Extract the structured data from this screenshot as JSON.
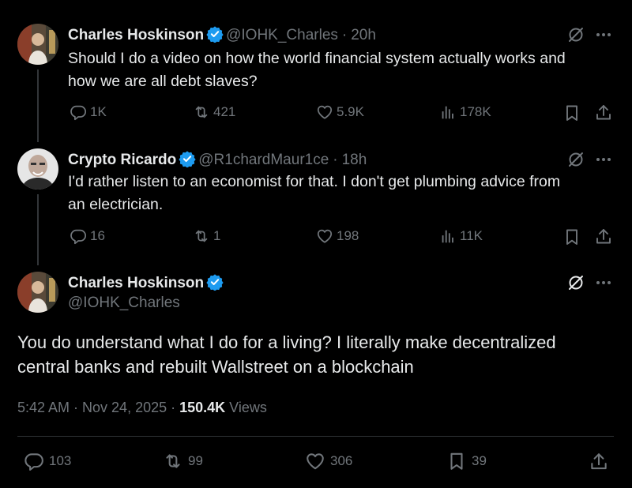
{
  "tweets": [
    {
      "name": "Charles Hoskinson",
      "handle": "@IOHK_Charles",
      "time_sep": "·",
      "time": "20h",
      "text_line1": "Should I do a video on how the world financial system actually works and",
      "text_line2": "how we are all debt slaves?",
      "replies": "1K",
      "reposts": "421",
      "likes": "5.9K",
      "views": "178K"
    },
    {
      "name": "Crypto Ricardo",
      "handle": "@R1chardMaur1ce",
      "time_sep": "·",
      "time": "18h",
      "text_line1": "I'd rather listen to an economist for that.  I don't get plumbing advice from",
      "text_line2": "an electrician.",
      "replies": "16",
      "reposts": "1",
      "likes": "198",
      "views": "11K"
    }
  ],
  "main": {
    "name": "Charles Hoskinson",
    "handle": "@IOHK_Charles",
    "text_line1": "You do understand what I do for a living? I literally make decentralized",
    "text_line2": "central banks and rebuilt Wallstreet on a blockchain",
    "timestamp": "5:42 AM · Nov 24, 2025",
    "sep": "·",
    "views_count": "150.4K",
    "views_label": "Views",
    "replies": "103",
    "reposts": "99",
    "likes": "306",
    "bookmarks": "39"
  },
  "colors": {
    "background": "#000000",
    "text": "#e7e9ea",
    "muted": "#71767b",
    "verified": "#1d9bf0"
  },
  "icons": [
    "reply-icon",
    "repost-icon",
    "like-icon",
    "views-icon",
    "bookmark-icon",
    "share-icon",
    "grok-icon",
    "more-icon",
    "verified-badge-icon"
  ]
}
